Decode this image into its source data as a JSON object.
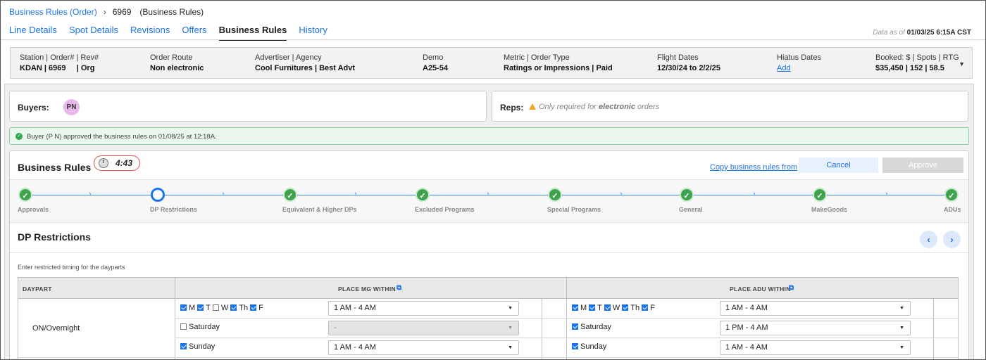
{
  "breadcrumb": {
    "parent": "Business Rules (Order)",
    "order_id": "6969",
    "current": "(Business Rules)"
  },
  "tabs": [
    "Line Details",
    "Spot Details",
    "Revisions",
    "Offers",
    "Business Rules",
    "History"
  ],
  "as_of": {
    "label": "Data as of",
    "value": "01/03/25 6:15A CST"
  },
  "summary": [
    {
      "label": "Station | Order# | Rev#",
      "value": "KDAN | 6969     | Org"
    },
    {
      "label": "Order Route",
      "value": "Non electronic"
    },
    {
      "label": "Advertiser | Agency",
      "value": "Cool Furnitures | Best Advt"
    },
    {
      "label": "Demo",
      "value": "A25-54"
    },
    {
      "label": "Metric | Order Type",
      "value": "Ratings or Impressions | Paid"
    },
    {
      "label": "Flight Dates",
      "value": "12/30/24 to 2/2/25"
    },
    {
      "label": "Hiatus Dates",
      "value": "Add"
    },
    {
      "label": "Booked: $ | Spots | RTG",
      "value": "$35,450 | 152 | 58.5"
    }
  ],
  "buyers": {
    "label": "Buyers:",
    "avatar": "PN"
  },
  "reps": {
    "label": "Reps:",
    "note_prefix": "Only required for",
    "note_bold": "electronic",
    "note_suffix": "orders"
  },
  "banner": "Buyer (P N) approved the business rules on 01/08/25 at 12:18A.",
  "business_rules": {
    "title": "Business Rules",
    "timer": "4:43",
    "copy_link": "Copy business rules from",
    "cancel": "Cancel",
    "approve": "Approve"
  },
  "steps": [
    {
      "label": "Approvals",
      "state": "done"
    },
    {
      "label": "DP Restrictions",
      "state": "current"
    },
    {
      "label": "Equivalent & Higher DPs",
      "state": "done"
    },
    {
      "label": "Excluded Programs",
      "state": "done"
    },
    {
      "label": "Special Programs",
      "state": "done"
    },
    {
      "label": "General",
      "state": "done"
    },
    {
      "label": "MakeGoods",
      "state": "done"
    },
    {
      "label": "ADUs",
      "state": "done"
    }
  ],
  "dp_restrictions": {
    "title": "DP Restrictions",
    "hint": "Enter restricted timing for the dayparts",
    "headers": {
      "daypart": "DAYPART",
      "mg": "PLACE MG WITHIN",
      "adu": "PLACE ADU WITHIN"
    },
    "daypart": "ON/Overnight",
    "weekday_labels": [
      "M",
      "T",
      "W",
      "Th",
      "F"
    ],
    "mg_weekdays": [
      true,
      true,
      false,
      true,
      true
    ],
    "adu_weekdays": [
      true,
      true,
      true,
      true,
      true
    ],
    "saturday": "Saturday",
    "sunday": "Sunday",
    "mg": {
      "weekday_time": "1 AM - 4 AM",
      "saturday_checked": false,
      "saturday_time": "-",
      "sunday_checked": true,
      "sunday_time": "1 AM - 4 AM"
    },
    "adu": {
      "weekday_time": "1 AM - 4 AM",
      "saturday_checked": true,
      "saturday_time": "1 PM - 4 AM",
      "sunday_checked": true,
      "sunday_time": "1 AM - 4 AM"
    }
  }
}
